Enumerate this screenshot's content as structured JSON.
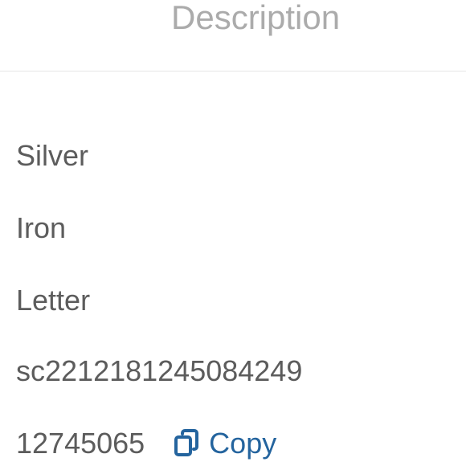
{
  "header": {
    "tab_label": "Description"
  },
  "details": {
    "rows": [
      {
        "value": "Silver"
      },
      {
        "value": "Iron"
      },
      {
        "value": "Letter"
      },
      {
        "value": "sc2212181245084249"
      },
      {
        "value": "12745065"
      }
    ],
    "copy_label": "Copy",
    "copy_icon": "copy-icon"
  },
  "colors": {
    "text": "#5c5c5c",
    "muted_tab": "#ababab",
    "accent": "#24649e",
    "divider": "#e6e6e6"
  }
}
